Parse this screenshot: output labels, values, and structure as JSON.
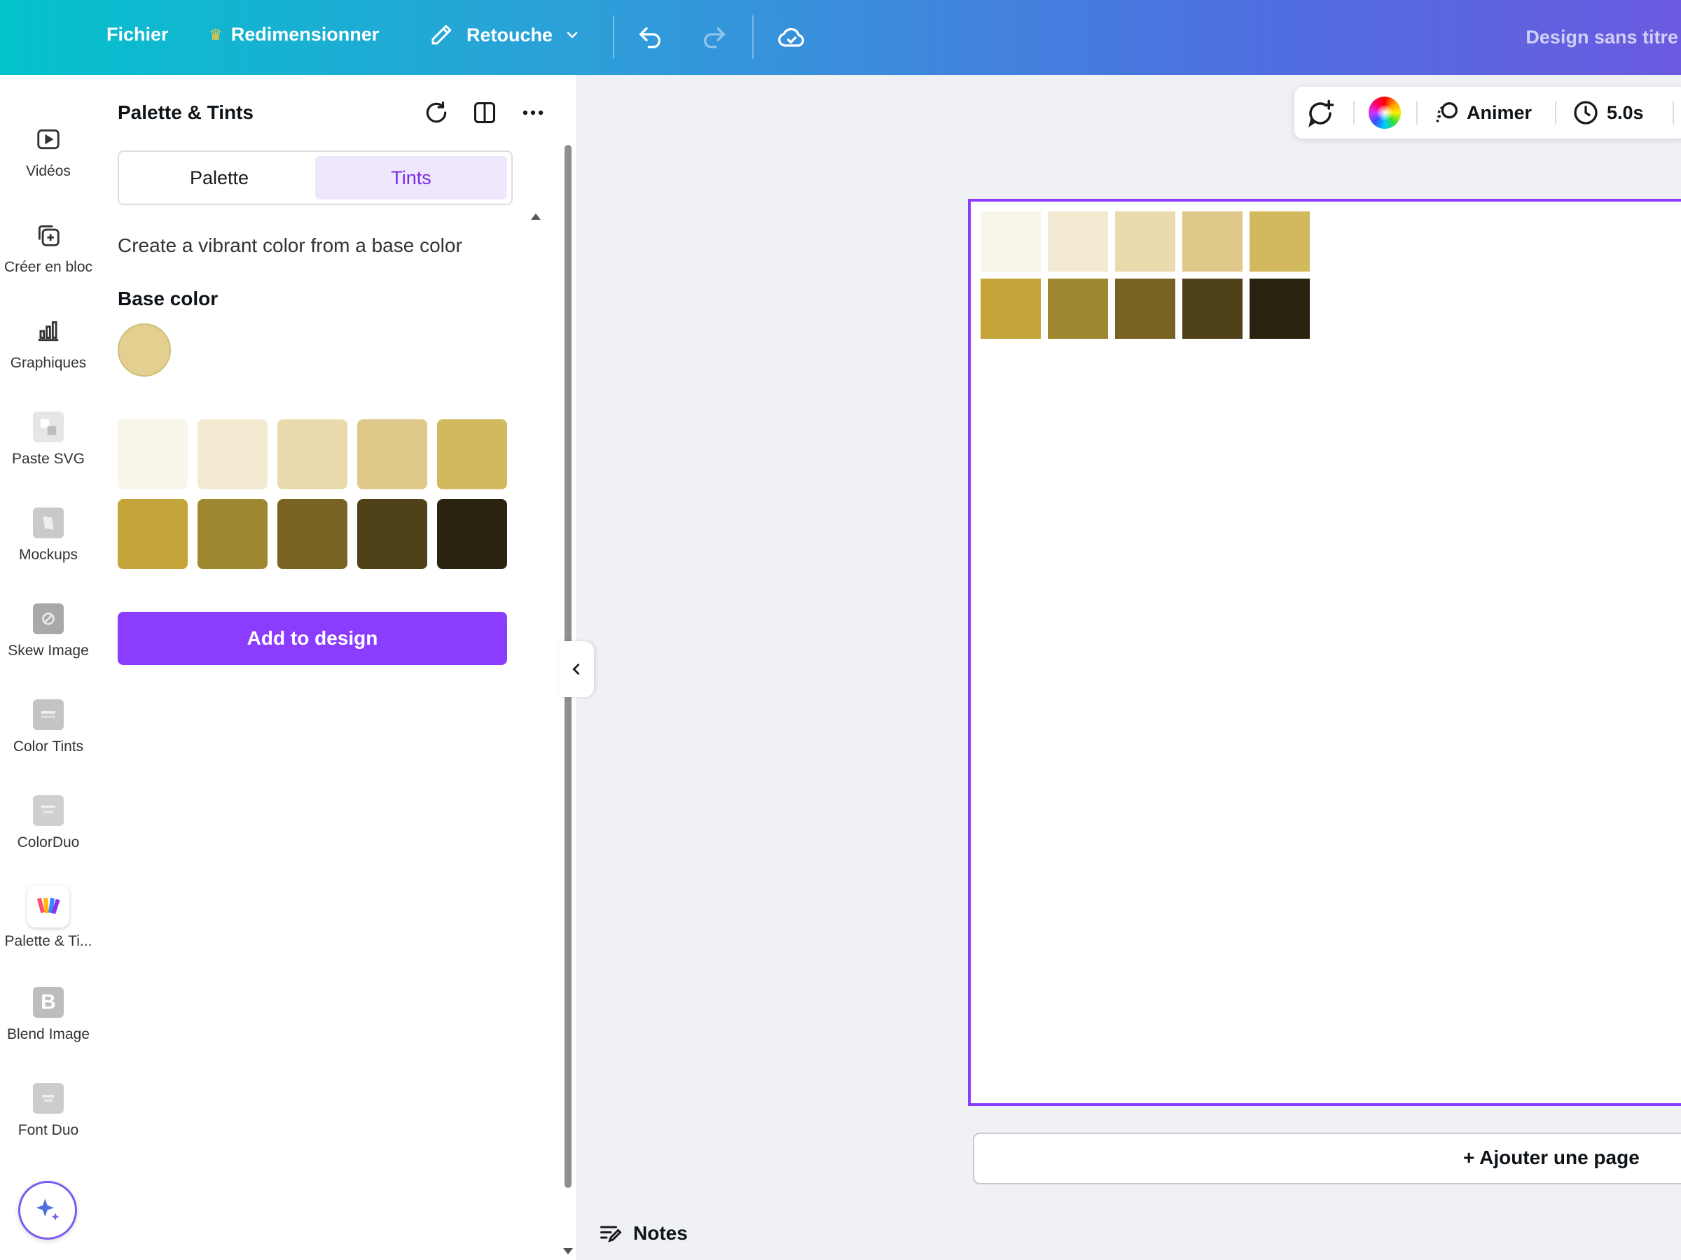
{
  "topbar": {
    "file_label": "Fichier",
    "resize_label": "Redimensionner",
    "retouch_label": "Retouche",
    "title": "Design sans titre"
  },
  "rail": {
    "items": [
      {
        "label": "Vidéos",
        "icon": "video-icon"
      },
      {
        "label": "Créer en bloc",
        "icon": "bulk-create-icon"
      },
      {
        "label": "Graphiques",
        "icon": "charts-icon"
      },
      {
        "label": "Paste SVG",
        "icon": "paste-svg-app-icon"
      },
      {
        "label": "Mockups",
        "icon": "mockups-app-icon"
      },
      {
        "label": "Skew Image",
        "icon": "skew-image-app-icon"
      },
      {
        "label": "Color Tints",
        "icon": "color-tints-app-icon"
      },
      {
        "label": "ColorDuo",
        "icon": "colorduo-app-icon"
      },
      {
        "label": "Palette & Ti...",
        "icon": "palette-tints-app-icon"
      },
      {
        "label": "Blend Image",
        "icon": "blend-image-app-icon"
      },
      {
        "label": "Font Duo",
        "icon": "font-duo-app-icon"
      }
    ]
  },
  "panel": {
    "title": "Palette & Tints",
    "tabs": [
      "Palette",
      "Tints"
    ],
    "active_tab": "Tints",
    "description": "Create a vibrant color from a base color",
    "base_color_label": "Base color",
    "base_color": "#e3cf8f",
    "tints": [
      "#f8f5ea",
      "#f3ead2",
      "#eadbaf",
      "#dfc98a",
      "#d3b95e",
      "#c4a53a",
      "#9e872f",
      "#786323",
      "#4f4219",
      "#2a2310"
    ],
    "add_button_label": "Add to design"
  },
  "float_toolbar": {
    "animate_label": "Animer",
    "duration_label": "5.0s"
  },
  "canvas": {
    "swatches": [
      "#f8f5ea",
      "#f3ead2",
      "#eadbaf",
      "#dfc98a",
      "#d3b95e",
      "#c4a53a",
      "#9e872f",
      "#786323",
      "#4f4219",
      "#2a2310"
    ],
    "add_page_label": "+ Ajouter une page",
    "notes_label": "Notes"
  },
  "colors": {
    "accent": "#8b3dff",
    "selection": "#8b3dff"
  }
}
